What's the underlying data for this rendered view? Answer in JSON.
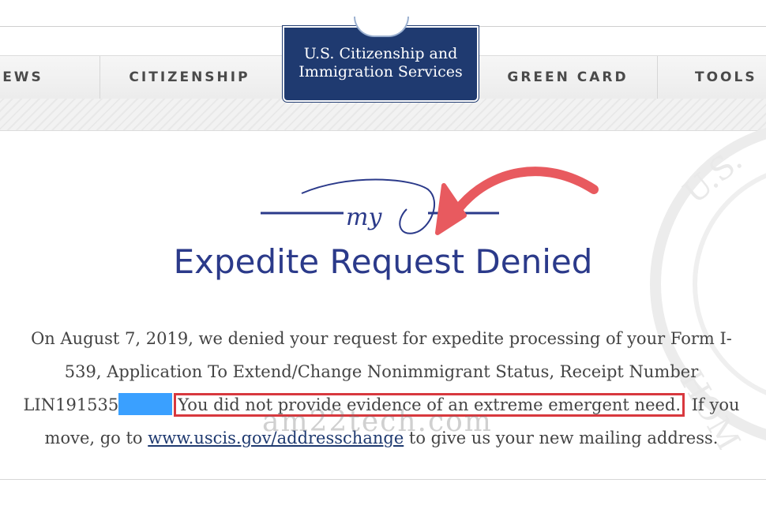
{
  "nav": {
    "items": [
      {
        "label": "EWS"
      },
      {
        "label": "CITIZENSHIP"
      },
      {
        "label": "GREEN CARD"
      },
      {
        "label": "TOOLS"
      }
    ]
  },
  "logo": {
    "line1": "U.S. Citizenship and",
    "line2": "Immigration Services"
  },
  "my_logo_text": "my",
  "title": "Expedite Request Denied",
  "message": {
    "line1": "On August 7, 2019, we denied your request for expedite processing of your Form I-",
    "line2": "539, Application To Extend/Change Nonimmigrant Status, Receipt Number",
    "receipt_prefix": "LIN191535",
    "highlighted": "You did not provide evidence of an extreme emergent need.",
    "after_highlight": " If you",
    "line4_prefix": "move, go to ",
    "link_text": "www.uscis.gov/addresschange",
    "line4_suffix": " to give us your new mailing address."
  },
  "watermark": "am22tech.com",
  "colors": {
    "brand_navy": "#1f3a70",
    "title_blue": "#2b3a8a",
    "annotation_red": "#d8383e",
    "redaction_blue": "#3aa0ff"
  },
  "icons": [
    "uscis-seal-icon",
    "red-arrow-icon",
    "dhs-seal-icon"
  ]
}
